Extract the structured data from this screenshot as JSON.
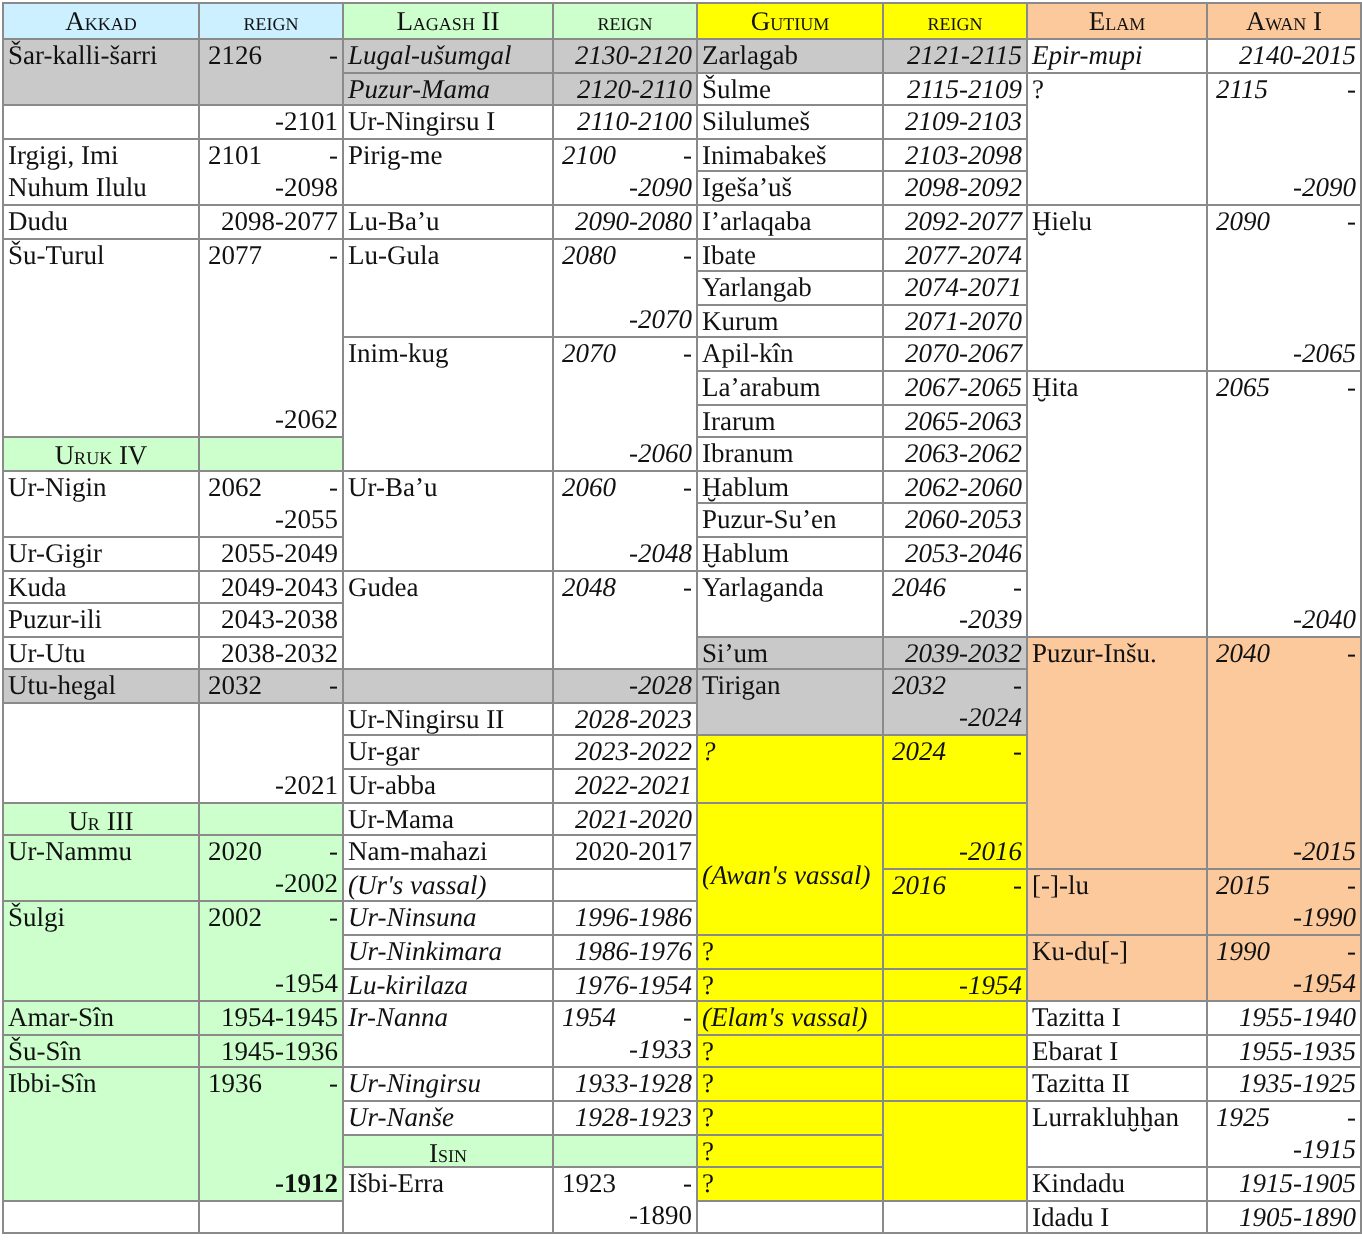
{
  "headings": [
    {
      "text": "Akkad",
      "color": "#ccf0ff"
    },
    {
      "text": "reign",
      "color": "#ccf0ff"
    },
    {
      "text": "Lagash II",
      "color": "#ccffcc"
    },
    {
      "text": "reign",
      "color": "#ccffcc"
    },
    {
      "text": "Gutium",
      "color": "#ffff00"
    },
    {
      "text": "reign",
      "color": "#ffff00"
    },
    {
      "text": "Elam",
      "color": "#fbc99b"
    },
    {
      "text": "Awan I",
      "color": "#fbc99b"
    }
  ],
  "rows": [
    {
      "cells": [
        {
          "kind": "name",
          "text": "Šar-kalli-šarri",
          "italic": false,
          "color": "#c9c9c9"
        },
        {
          "kind": "period",
          "start": "2126",
          "dash": "-",
          "italic": false,
          "color": "#c9c9c9"
        },
        {
          "kind": "name",
          "text": "Lugal-ušumgal",
          "italic": true,
          "color": "#c9c9c9"
        },
        {
          "kind": "range",
          "text": "2130-2120",
          "italic": true,
          "color": "#c9c9c9"
        },
        {
          "kind": "name",
          "text": "Zarlagab",
          "italic": false,
          "color": "#c9c9c9"
        },
        {
          "kind": "range",
          "text": "2121-2115",
          "italic": true,
          "color": "#c9c9c9"
        },
        {
          "kind": "name",
          "text": "Epir-mupi",
          "italic": true
        },
        {
          "kind": "range",
          "text": "2140-2015",
          "italic": true
        }
      ]
    },
    {
      "cells": [
        null,
        null,
        {
          "kind": "name",
          "text": "Puzur-Mama",
          "italic": true,
          "color": "#c9c9c9"
        },
        {
          "kind": "range",
          "text": "2120-2110",
          "italic": true,
          "color": "#c9c9c9"
        },
        {
          "kind": "name",
          "text": "Šulme",
          "italic": false
        },
        {
          "kind": "range",
          "text": "2115-2109",
          "italic": true
        },
        {
          "kind": "name",
          "text": "?",
          "italic": false
        },
        {
          "kind": "period",
          "start": "2115",
          "dash": "-",
          "end": "-2090",
          "italic": true
        }
      ]
    },
    {
      "cells": [
        {
          "kind": "blank"
        },
        {
          "kind": "period",
          "end": "-2101",
          "italic": false
        },
        {
          "kind": "name",
          "text": "Ur-Ningirsu I",
          "italic": false
        },
        {
          "kind": "range",
          "text": "2110-2100",
          "italic": true
        },
        {
          "kind": "name",
          "text": "Silulumeš",
          "italic": false
        },
        {
          "kind": "range",
          "text": "2109-2103",
          "italic": true
        },
        null,
        null
      ]
    },
    {
      "cells": [
        {
          "kind": "name",
          "text": "Irgigi, Imi\nNuhum Ilulu",
          "italic": false
        },
        {
          "kind": "period",
          "start": "2101",
          "dash": "-",
          "end": "-2098",
          "italic": false
        },
        {
          "kind": "name",
          "text": "Pirig-me",
          "italic": false
        },
        {
          "kind": "period",
          "start": "2100",
          "dash": "-",
          "end": "-2090",
          "italic": true
        },
        {
          "kind": "name",
          "text": "Inimabakeš",
          "italic": false
        },
        {
          "kind": "range",
          "text": "2103-2098",
          "italic": true
        },
        null,
        null
      ]
    },
    {
      "cells": [
        null,
        null,
        null,
        null,
        {
          "kind": "name",
          "text": "Igeša’uš",
          "italic": false
        },
        {
          "kind": "range",
          "text": "2098-2092",
          "italic": true
        },
        null,
        null
      ]
    },
    {
      "cells": [
        {
          "kind": "name",
          "text": "Dudu",
          "italic": false
        },
        {
          "kind": "range",
          "text": "2098-2077",
          "italic": false
        },
        {
          "kind": "name",
          "text": "Lu-Ba’u",
          "italic": false
        },
        {
          "kind": "range",
          "text": "2090-2080",
          "italic": true
        },
        {
          "kind": "name",
          "text": "I’arlaqaba",
          "italic": false
        },
        {
          "kind": "range",
          "text": "2092-2077",
          "italic": true
        },
        {
          "kind": "name",
          "text": "Ḫielu",
          "italic": false
        },
        {
          "kind": "period",
          "start": "2090",
          "dash": "-",
          "end": "-2065",
          "italic": true
        }
      ]
    },
    {
      "cells": [
        {
          "kind": "name",
          "text": "Šu-Turul",
          "italic": false
        },
        {
          "kind": "period",
          "start": "2077",
          "dash": "-",
          "end": "-2062",
          "italic": false
        },
        {
          "kind": "name",
          "text": "Lu-Gula",
          "italic": false
        },
        {
          "kind": "period",
          "start": "2080",
          "dash": "-",
          "end": "-2070",
          "italic": true
        },
        {
          "kind": "name",
          "text": "Ibate",
          "italic": false
        },
        {
          "kind": "range",
          "text": "2077-2074",
          "italic": true
        },
        null,
        null
      ]
    },
    {
      "cells": [
        null,
        null,
        null,
        null,
        {
          "kind": "name",
          "text": "Yarlangab",
          "italic": false
        },
        {
          "kind": "range",
          "text": "2074-2071",
          "italic": true
        },
        null,
        null
      ]
    },
    {
      "cells": [
        null,
        null,
        null,
        null,
        {
          "kind": "name",
          "text": "Kurum",
          "italic": false
        },
        {
          "kind": "range",
          "text": "2071-2070",
          "italic": true
        },
        null,
        null
      ]
    },
    {
      "cells": [
        null,
        null,
        {
          "kind": "name",
          "text": "Inim-kug",
          "italic": false
        },
        {
          "kind": "period",
          "start": "2070",
          "dash": "-",
          "end": "-2060",
          "italic": true
        },
        {
          "kind": "name",
          "text": "Apil-kîn",
          "italic": false
        },
        {
          "kind": "range",
          "text": "2070-2067",
          "italic": true
        },
        null,
        null
      ]
    },
    {
      "cells": [
        null,
        null,
        null,
        null,
        {
          "kind": "name",
          "text": "La’arabum",
          "italic": false
        },
        {
          "kind": "range",
          "text": "2067-2065",
          "italic": true
        },
        {
          "kind": "name",
          "text": "Ḫita",
          "italic": false
        },
        {
          "kind": "period",
          "start": "2065",
          "dash": "-",
          "end": "-2040",
          "italic": true
        }
      ]
    },
    {
      "cells": [
        null,
        null,
        null,
        null,
        {
          "kind": "name",
          "text": "Irarum",
          "italic": false
        },
        {
          "kind": "range",
          "text": "2065-2063",
          "italic": true
        },
        null,
        null
      ]
    },
    {
      "cells": [
        {
          "kind": "heading",
          "text": "Uruk IV",
          "color": "#ccffcc"
        },
        {
          "kind": "blank",
          "color": "#ccffcc"
        },
        null,
        null,
        {
          "kind": "name",
          "text": "Ibranum",
          "italic": false
        },
        {
          "kind": "range",
          "text": "2063-2062",
          "italic": true
        },
        null,
        null
      ]
    },
    {
      "cells": [
        {
          "kind": "name",
          "text": "Ur-Nigin",
          "italic": false
        },
        {
          "kind": "period",
          "start": "2062",
          "dash": "-",
          "end": "-2055",
          "italic": false
        },
        {
          "kind": "name",
          "text": "Ur-Ba’u",
          "italic": false
        },
        {
          "kind": "period",
          "start": "2060",
          "dash": "-",
          "end": "-2048",
          "italic": true
        },
        {
          "kind": "name",
          "text": "Ḫablum",
          "italic": false
        },
        {
          "kind": "range",
          "text": "2062-2060",
          "italic": true
        },
        null,
        null
      ]
    },
    {
      "cells": [
        null,
        null,
        null,
        null,
        {
          "kind": "name",
          "text": "Puzur-Su’en",
          "italic": false
        },
        {
          "kind": "range",
          "text": "2060-2053",
          "italic": true
        },
        null,
        null
      ]
    },
    {
      "cells": [
        {
          "kind": "name",
          "text": "Ur-Gigir",
          "italic": false
        },
        {
          "kind": "range",
          "text": "2055-2049",
          "italic": false
        },
        null,
        null,
        {
          "kind": "name",
          "text": "Ḫablum",
          "italic": false
        },
        {
          "kind": "range",
          "text": "2053-2046",
          "italic": true
        },
        null,
        null
      ]
    },
    {
      "cells": [
        {
          "kind": "name",
          "text": "Kuda",
          "italic": false
        },
        {
          "kind": "range",
          "text": "2049-2043",
          "italic": false
        },
        {
          "kind": "name",
          "text": "Gudea",
          "italic": false
        },
        {
          "kind": "period",
          "start": "2048",
          "dash": "-",
          "italic": true
        },
        {
          "kind": "name",
          "text": "Yarlaganda",
          "italic": false
        },
        {
          "kind": "period",
          "start": "2046",
          "dash": "-",
          "end": "-2039",
          "italic": true
        },
        null,
        null
      ]
    },
    {
      "cells": [
        {
          "kind": "name",
          "text": "Puzur-ili",
          "italic": false
        },
        {
          "kind": "range",
          "text": "2043-2038",
          "italic": false
        },
        null,
        null,
        null,
        null,
        null,
        null
      ]
    },
    {
      "cells": [
        {
          "kind": "name",
          "text": "Ur-Utu",
          "italic": false
        },
        {
          "kind": "range",
          "text": "2038-2032",
          "italic": false
        },
        null,
        null,
        {
          "kind": "name",
          "text": "Si’um",
          "italic": false,
          "color": "#c9c9c9"
        },
        {
          "kind": "range",
          "text": "2039-2032",
          "italic": true,
          "color": "#c9c9c9"
        },
        {
          "kind": "name",
          "text": "Puzur-Inšu.",
          "italic": false,
          "color": "#fbc99b"
        },
        {
          "kind": "period",
          "start": "2040",
          "dash": "-",
          "end": "-2015",
          "italic": true,
          "color": "#fbc99b"
        }
      ]
    },
    {
      "cells": [
        {
          "kind": "name",
          "text": "Utu-hegal",
          "italic": false,
          "color": "#c9c9c9"
        },
        {
          "kind": "period",
          "start": "2032",
          "dash": "-",
          "italic": false,
          "color": "#c9c9c9"
        },
        {
          "kind": "blank",
          "color": "#c9c9c9"
        },
        {
          "kind": "period",
          "end": "-2028",
          "italic": true,
          "color": "#c9c9c9"
        },
        {
          "kind": "name",
          "text": "Tirigan",
          "italic": false,
          "color": "#c9c9c9"
        },
        {
          "kind": "period",
          "start": "2032",
          "dash": "-",
          "end": "-2024",
          "italic": true,
          "color": "#c9c9c9"
        },
        null,
        null
      ]
    },
    {
      "cells": [
        {
          "kind": "blank"
        },
        {
          "kind": "period",
          "end": "-2021",
          "italic": false
        },
        {
          "kind": "name",
          "text": "Ur-Ningirsu II",
          "italic": false
        },
        {
          "kind": "range",
          "text": "2028-2023",
          "italic": true
        },
        null,
        null,
        null,
        null
      ]
    },
    {
      "cells": [
        null,
        null,
        {
          "kind": "name",
          "text": "Ur-gar",
          "italic": false
        },
        {
          "kind": "range",
          "text": "2023-2022",
          "italic": true
        },
        {
          "kind": "name",
          "text": "?",
          "italic": true,
          "color": "#ffff00"
        },
        {
          "kind": "period",
          "start": "2024",
          "dash": "-",
          "italic": true,
          "color": "#ffff00"
        },
        null,
        null
      ]
    },
    {
      "cells": [
        null,
        null,
        {
          "kind": "name",
          "text": "Ur-abba",
          "italic": false
        },
        {
          "kind": "range",
          "text": "2022-2021",
          "italic": true
        },
        null,
        null,
        null,
        null
      ]
    },
    {
      "cells": [
        {
          "kind": "heading",
          "text": "Ur III",
          "color": "#ccffcc"
        },
        {
          "kind": "blank",
          "color": "#ccffcc"
        },
        {
          "kind": "name",
          "text": "Ur-Mama",
          "italic": false
        },
        {
          "kind": "range",
          "text": "2021-2020",
          "italic": true
        },
        {
          "kind": "note",
          "text": "(Awan's vassal)",
          "italic": true,
          "color": "#ffff00"
        },
        {
          "kind": "period",
          "end": "-2016",
          "italic": true,
          "color": "#ffff00"
        },
        null,
        null
      ]
    },
    {
      "cells": [
        {
          "kind": "name",
          "text": "Ur-Nammu",
          "italic": false,
          "color": "#ccffcc"
        },
        {
          "kind": "period",
          "start": "2020",
          "dash": "-",
          "end": "-2002",
          "italic": false,
          "color": "#ccffcc"
        },
        {
          "kind": "name",
          "text": "Nam-mahazi",
          "italic": false
        },
        {
          "kind": "range",
          "text": "2020-2017",
          "italic": false
        },
        null,
        null,
        null,
        null
      ]
    },
    {
      "cells": [
        null,
        null,
        {
          "kind": "name",
          "text": "(Ur's vassal)",
          "italic": true
        },
        {
          "kind": "blank"
        },
        null,
        {
          "kind": "period",
          "start": "2016",
          "dash": "-",
          "italic": true,
          "color": "#ffff00"
        },
        {
          "kind": "name",
          "text": "[-]-lu",
          "italic": false,
          "color": "#fbc99b"
        },
        {
          "kind": "period",
          "start": "2015",
          "dash": "-",
          "end": "-1990",
          "italic": true,
          "color": "#fbc99b"
        }
      ]
    },
    {
      "cells": [
        {
          "kind": "name",
          "text": "Šulgi",
          "italic": false,
          "color": "#ccffcc"
        },
        {
          "kind": "period",
          "start": "2002",
          "dash": "-",
          "end": "-1954",
          "italic": false,
          "color": "#ccffcc"
        },
        {
          "kind": "name",
          "text": "Ur-Ninsuna",
          "italic": true
        },
        {
          "kind": "range",
          "text": "1996-1986",
          "italic": true
        },
        null,
        null,
        null,
        null
      ]
    },
    {
      "cells": [
        null,
        null,
        {
          "kind": "name",
          "text": "Ur-Ninkimara",
          "italic": true
        },
        {
          "kind": "range",
          "text": "1986-1976",
          "italic": true
        },
        {
          "kind": "name",
          "text": "?",
          "italic": false,
          "color": "#ffff00"
        },
        {
          "kind": "blank",
          "color": "#ffff00"
        },
        {
          "kind": "name",
          "text": "Ku-du[-]",
          "italic": false,
          "color": "#fbc99b"
        },
        {
          "kind": "period",
          "start": "1990",
          "dash": "-",
          "end": "-1954",
          "italic": true,
          "color": "#fbc99b"
        }
      ]
    },
    {
      "cells": [
        null,
        null,
        {
          "kind": "name",
          "text": "Lu-kirilaza",
          "italic": true
        },
        {
          "kind": "range",
          "text": "1976-1954",
          "italic": true
        },
        {
          "kind": "name",
          "text": "?",
          "italic": false,
          "color": "#ffff00"
        },
        {
          "kind": "period",
          "end": "-1954",
          "italic": true,
          "color": "#ffff00"
        },
        null,
        null
      ]
    },
    {
      "cells": [
        {
          "kind": "name",
          "text": "Amar-Sîn",
          "italic": false,
          "color": "#ccffcc"
        },
        {
          "kind": "range",
          "text": "1954-1945",
          "italic": false,
          "color": "#ccffcc"
        },
        {
          "kind": "name",
          "text": "Ir-Nanna",
          "italic": true
        },
        {
          "kind": "period",
          "start": "1954",
          "dash": "-",
          "end": "-1933",
          "italic": true
        },
        {
          "kind": "name",
          "text": "(Elam's vassal)",
          "italic": true,
          "color": "#ffff00"
        },
        {
          "kind": "blank",
          "color": "#ffff00"
        },
        {
          "kind": "name",
          "text": "Tazitta I",
          "italic": false
        },
        {
          "kind": "range",
          "text": "1955-1940",
          "italic": true
        }
      ]
    },
    {
      "cells": [
        {
          "kind": "name",
          "text": "Šu-Sîn",
          "italic": false,
          "color": "#ccffcc"
        },
        {
          "kind": "range",
          "text": "1945-1936",
          "italic": false,
          "color": "#ccffcc"
        },
        null,
        null,
        {
          "kind": "name",
          "text": "?",
          "italic": false,
          "color": "#ffff00"
        },
        {
          "kind": "blank",
          "color": "#ffff00"
        },
        {
          "kind": "name",
          "text": "Ebarat I",
          "italic": false
        },
        {
          "kind": "range",
          "text": "1955-1935",
          "italic": true
        }
      ]
    },
    {
      "cells": [
        {
          "kind": "name",
          "text": "Ibbi-Sîn",
          "italic": false,
          "color": "#ccffcc"
        },
        {
          "kind": "period",
          "start": "1936",
          "dash": "-",
          "end": "-1912",
          "italic": false,
          "bold": true,
          "color": "#ccffcc"
        },
        {
          "kind": "name",
          "text": "Ur-Ningirsu",
          "italic": true
        },
        {
          "kind": "range",
          "text": "1933-1928",
          "italic": true
        },
        {
          "kind": "name",
          "text": "?",
          "italic": false,
          "color": "#ffff00"
        },
        {
          "kind": "blank",
          "color": "#ffff00"
        },
        {
          "kind": "name",
          "text": "Tazitta II",
          "italic": false
        },
        {
          "kind": "range",
          "text": "1935-1925",
          "italic": true
        }
      ]
    },
    {
      "cells": [
        null,
        null,
        {
          "kind": "name",
          "text": "Ur-Nanše",
          "italic": true
        },
        {
          "kind": "range",
          "text": "1928-1923",
          "italic": true
        },
        {
          "kind": "name",
          "text": "?",
          "italic": false,
          "color": "#ffff00"
        },
        {
          "kind": "blank",
          "color": "#ffff00"
        },
        {
          "kind": "name",
          "text": "Lurrakluḫḫan",
          "italic": false
        },
        {
          "kind": "period",
          "start": "1925",
          "dash": "-",
          "end": "-1915",
          "italic": true
        }
      ]
    },
    {
      "cells": [
        null,
        null,
        {
          "kind": "heading",
          "text": "Isin",
          "color": "#ccffcc"
        },
        {
          "kind": "blank",
          "color": "#ccffcc"
        },
        {
          "kind": "name",
          "text": "?",
          "italic": false,
          "color": "#ffff00"
        },
        null,
        null,
        null
      ]
    },
    {
      "cells": [
        null,
        null,
        {
          "kind": "name",
          "text": "Išbi-Erra",
          "italic": false
        },
        {
          "kind": "period",
          "start": "1923",
          "dash": "-",
          "end": "-1890",
          "italic": false
        },
        {
          "kind": "name",
          "text": "?",
          "italic": false,
          "color": "#ffff00"
        },
        null,
        {
          "kind": "name",
          "text": "Kindadu",
          "italic": false
        },
        {
          "kind": "range",
          "text": "1915-1905",
          "italic": true
        }
      ]
    },
    {
      "cells": [
        {
          "kind": "blank"
        },
        {
          "kind": "blank"
        },
        null,
        null,
        {
          "kind": "blank"
        },
        {
          "kind": "blank"
        },
        {
          "kind": "name",
          "text": "Idadu I",
          "italic": false
        },
        {
          "kind": "range",
          "text": "1905-1890",
          "italic": true
        }
      ]
    }
  ]
}
